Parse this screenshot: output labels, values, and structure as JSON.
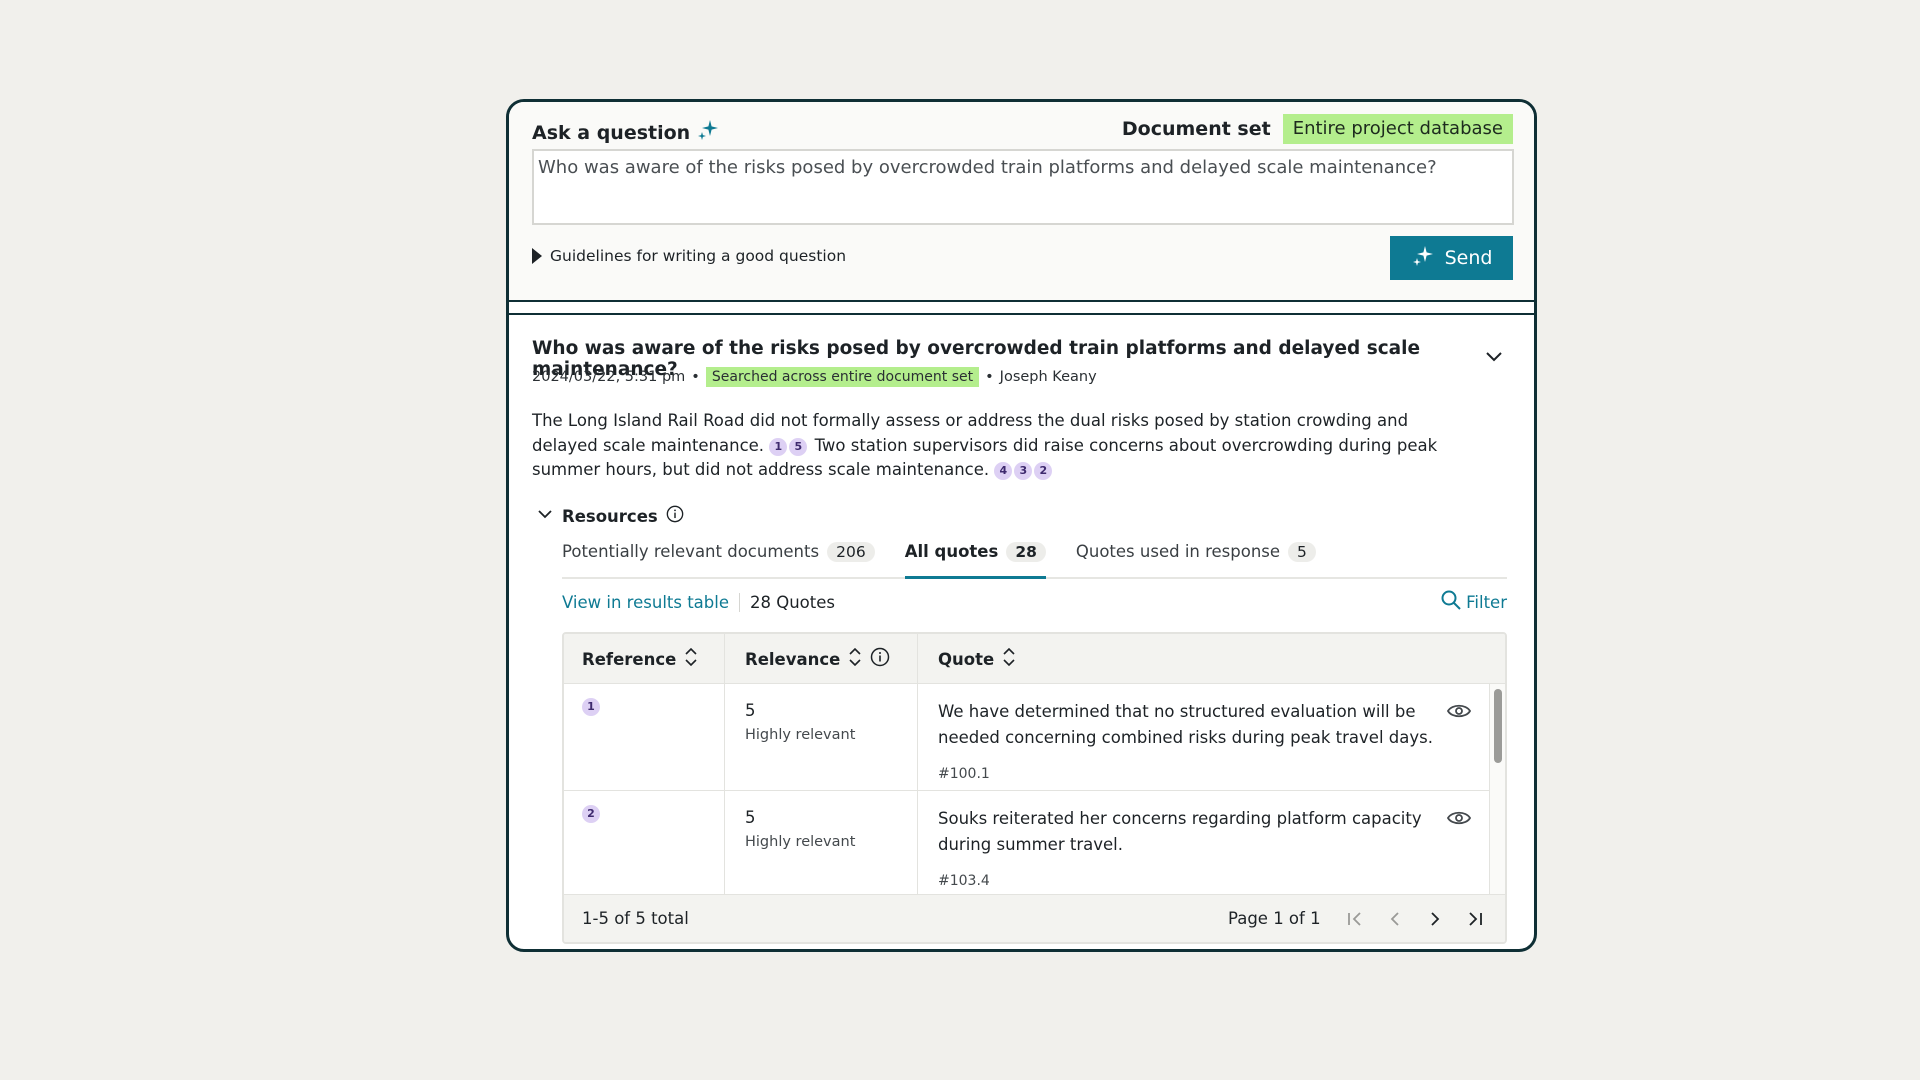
{
  "ask": {
    "title": "Ask a question",
    "document_set_label": "Document set",
    "document_set_value": "Entire project database",
    "question_value": "Who was aware of the risks posed by overcrowded train platforms and delayed scale maintenance?",
    "guidelines_label": "Guidelines for writing a good question",
    "send_label": "Send"
  },
  "result": {
    "question": "Who was aware of the risks posed by overcrowded train platforms and delayed scale maintenance?",
    "timestamp": "2024/03/22, 5:31 pm",
    "scope_badge": "Searched across entire document set",
    "author": "Joseph Keany",
    "answer_part1": "The Long Island Rail Road did not formally assess or address the dual risks posed by station crowding and delayed scale maintenance.",
    "answer_part1_citations": [
      "1",
      "5"
    ],
    "answer_part2": "Two station supervisors did raise concerns about overcrowding during peak summer hours, but did not address scale maintenance.",
    "answer_part2_citations": [
      "4",
      "3",
      "2"
    ]
  },
  "resources": {
    "label": "Resources",
    "tabs": [
      {
        "label": "Potentially relevant documents",
        "count": "206"
      },
      {
        "label": "All quotes",
        "count": "28",
        "active": true
      },
      {
        "label": "Quotes used in response",
        "count": "5"
      }
    ],
    "view_link": "View in results table",
    "quotes_count": "28 Quotes",
    "filter_label": "Filter"
  },
  "table": {
    "columns": [
      "Reference",
      "Relevance",
      "Quote"
    ],
    "rows": [
      {
        "ref": "1",
        "relevance": "5",
        "relevance_label": "Highly relevant",
        "quote": "We have determined that no structured evaluation will be needed concerning combined risks during peak travel days.",
        "quote_ref": "#100.1"
      },
      {
        "ref": "2",
        "relevance": "5",
        "relevance_label": "Highly relevant",
        "quote": "Souks reiterated her concerns regarding platform capacity during summer travel.",
        "quote_ref": "#103.4"
      }
    ],
    "total": "1-5 of 5 total",
    "page_info": "Page 1 of 1"
  },
  "colors": {
    "accent": "#0e7a93",
    "highlight_green": "#b4ee8d",
    "citation_purple": "#ddd0f4",
    "border_dark": "#0f2f35"
  }
}
